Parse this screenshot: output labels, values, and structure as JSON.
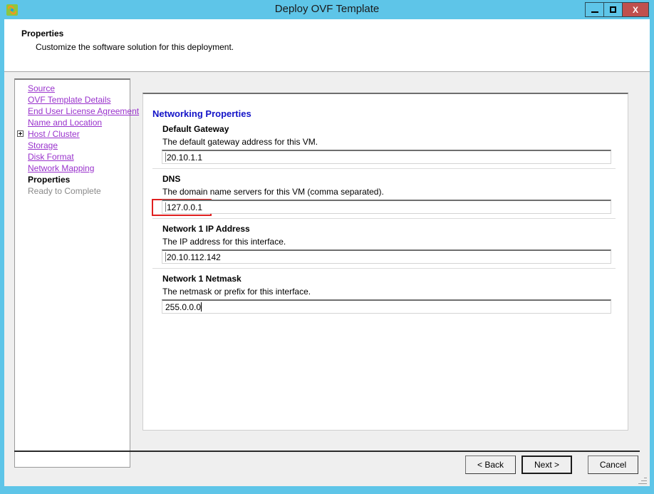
{
  "window": {
    "title": "Deploy OVF Template",
    "icon": "ovf-package-icon",
    "controls": {
      "minimize": "minimize-icon",
      "maximize": "maximize-icon",
      "close": "X"
    },
    "accent_color": "#5ec5e8",
    "close_color": "#c0504d"
  },
  "header": {
    "title": "Properties",
    "subtitle": "Customize the software solution for this deployment."
  },
  "sidebar": {
    "items": [
      {
        "label": "Source",
        "state": "link",
        "expander": false
      },
      {
        "label": "OVF Template Details",
        "state": "link",
        "expander": false
      },
      {
        "label": "End User License Agreement",
        "state": "link",
        "expander": false
      },
      {
        "label": "Name and Location",
        "state": "link",
        "expander": false
      },
      {
        "label": "Host / Cluster",
        "state": "link",
        "expander": true
      },
      {
        "label": "Storage",
        "state": "link",
        "expander": false
      },
      {
        "label": "Disk Format",
        "state": "link",
        "expander": false
      },
      {
        "label": "Network Mapping",
        "state": "link",
        "expander": false
      },
      {
        "label": "Properties",
        "state": "current",
        "expander": false
      },
      {
        "label": "Ready to Complete",
        "state": "disabled",
        "expander": false
      }
    ],
    "link_color": "#9932cc"
  },
  "content": {
    "section_title": "Networking Properties",
    "section_title_color": "#1414c8",
    "properties": [
      {
        "label": "Default Gateway",
        "description": "The default gateway address for this VM.",
        "value": "20.10.1.1",
        "highlighted": false,
        "focused": false
      },
      {
        "label": "DNS",
        "description": "The domain name servers for this VM (comma separated).",
        "value": "127.0.0.1",
        "highlighted": true,
        "focused": false
      },
      {
        "label": "Network 1 IP Address",
        "description": "The IP address for this interface.",
        "value": "20.10.112.142",
        "highlighted": false,
        "focused": false
      },
      {
        "label": "Network 1 Netmask",
        "description": "The netmask or prefix for this interface.",
        "value": "255.0.0.0",
        "highlighted": false,
        "focused": true
      }
    ],
    "highlight_color": "#e02020"
  },
  "footer": {
    "back_label": "< Back",
    "next_label": "Next >",
    "cancel_label": "Cancel",
    "default_button": "next",
    "resize_grip": "resize-grip-icon"
  }
}
